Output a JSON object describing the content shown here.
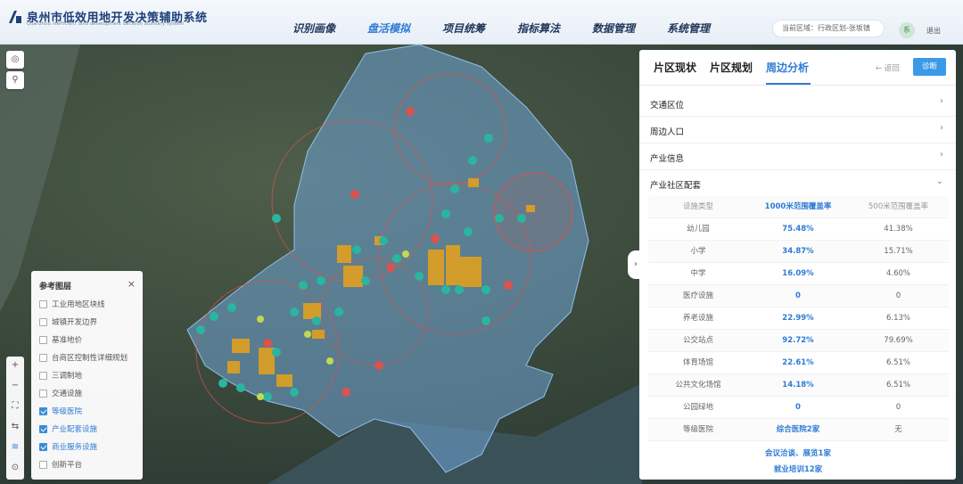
{
  "header": {
    "title": "泉州市低效用地开发决策辅助系统",
    "subtitle": "Quanzhou inefficient land development decision auxiliary system",
    "nav": [
      {
        "label": "识别画像",
        "active": false
      },
      {
        "label": "盘活模拟",
        "active": true
      },
      {
        "label": "项目统筹",
        "active": false
      },
      {
        "label": "指标算法",
        "active": false
      },
      {
        "label": "数据管理",
        "active": false
      },
      {
        "label": "系统管理",
        "active": false
      }
    ],
    "region": "当前区域：行政区划-张坂镇",
    "avatar": "系",
    "logout": "退出"
  },
  "layers": {
    "title": "参考图层",
    "close": "×",
    "items": [
      {
        "label": "工业用地区块线",
        "checked": false
      },
      {
        "label": "城镇开发边界",
        "checked": false
      },
      {
        "label": "基准地价",
        "checked": false
      },
      {
        "label": "台商区控制性详细规划",
        "checked": false
      },
      {
        "label": "三调制地",
        "checked": false
      },
      {
        "label": "交通设施",
        "checked": false
      },
      {
        "label": "等级医院",
        "checked": true
      },
      {
        "label": "产业配套设施",
        "checked": true
      },
      {
        "label": "商业服务设施",
        "checked": true
      },
      {
        "label": "创新平台",
        "checked": false
      }
    ]
  },
  "tools": {
    "zoom_in": "+",
    "zoom_out": "−",
    "fullscreen": "⛶",
    "swap": "⇆",
    "layers": "≋",
    "locate": "⊙"
  },
  "map_controls": {
    "rotate": "◎",
    "pin": "⚲"
  },
  "panel": {
    "tabs": [
      {
        "label": "片区现状",
        "active": false
      },
      {
        "label": "片区规划",
        "active": false
      },
      {
        "label": "周边分析",
        "active": true
      }
    ],
    "back": "← 返回",
    "diagnose": "诊断",
    "sections": [
      {
        "label": "交通区位",
        "chev": "›"
      },
      {
        "label": "周边人口",
        "chev": "›"
      },
      {
        "label": "产业信息",
        "chev": "›"
      },
      {
        "label": "产业社区配套",
        "chev": "⌄"
      }
    ],
    "table": {
      "headers": [
        "设施类型",
        "1000米范围覆盖率",
        "500米范围覆盖率"
      ],
      "rows": [
        [
          "幼儿园",
          "75.48%",
          "41.38%"
        ],
        [
          "小学",
          "34.87%",
          "15.71%"
        ],
        [
          "中学",
          "16.09%",
          "4.60%"
        ],
        [
          "医疗设施",
          "0",
          "0"
        ],
        [
          "养老设施",
          "22.99%",
          "6.13%"
        ],
        [
          "公交站点",
          "92.72%",
          "79.69%"
        ],
        [
          "体育场馆",
          "22.61%",
          "6.51%"
        ],
        [
          "公共文化场馆",
          "14.18%",
          "6.51%"
        ],
        [
          "公园绿地",
          "0",
          "0"
        ],
        [
          "等级医院",
          "综合医院2家",
          "无"
        ]
      ],
      "extra": [
        "会议洽谈、展览1家",
        "就业培训12家"
      ]
    }
  },
  "colors": {
    "accent": "#2e7bd6",
    "region_fill": "#6fa4d6",
    "buffer_red": "#d9534f",
    "parcel": "#e0a020",
    "poi": "#2ab5a0"
  }
}
